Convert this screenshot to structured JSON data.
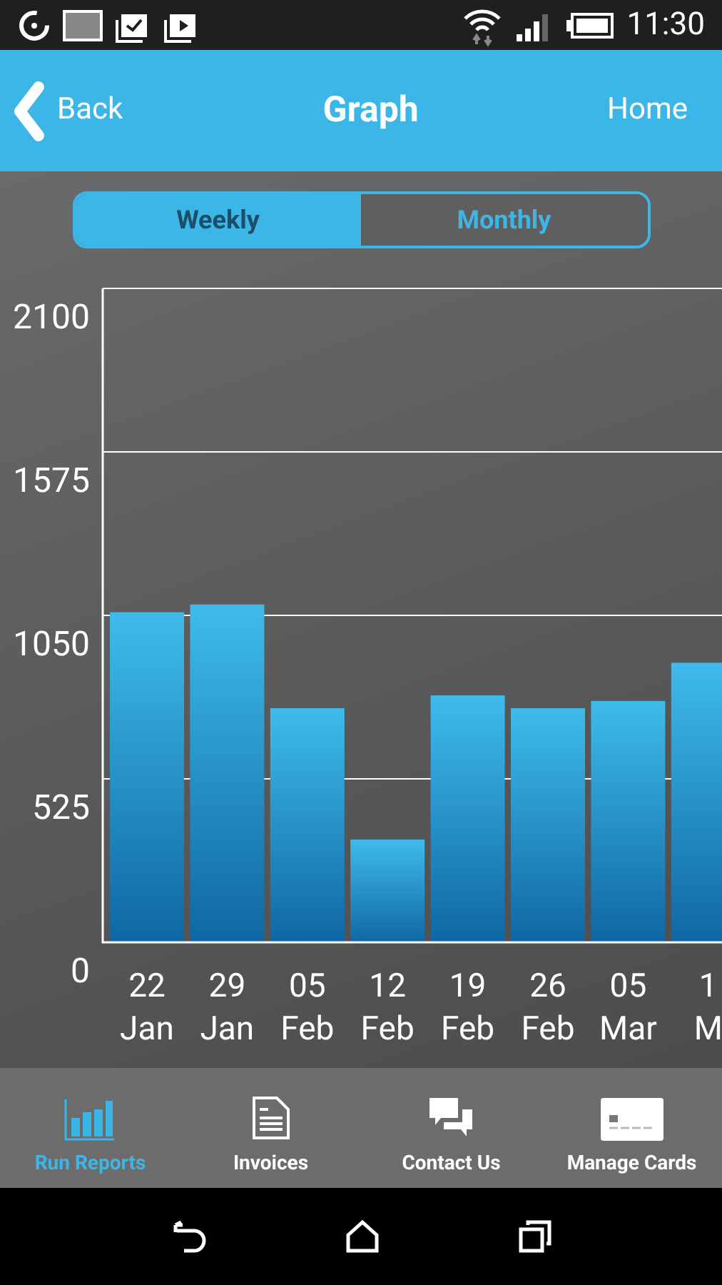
{
  "status_bar": {
    "time": "11:30"
  },
  "header": {
    "back": "Back",
    "title": "Graph",
    "home": "Home"
  },
  "tabs": [
    {
      "label": "Weekly",
      "selected": true
    },
    {
      "label": "Monthly",
      "selected": false
    }
  ],
  "chart_data": {
    "type": "bar",
    "categories": [
      "22 Jan",
      "29 Jan",
      "05 Feb",
      "12 Feb",
      "19 Feb",
      "26 Feb",
      "05 Mar",
      "1 M"
    ],
    "values": [
      1060,
      1085,
      752,
      330,
      793,
      752,
      775,
      898
    ],
    "ylim": [
      0,
      2100
    ],
    "grid": true,
    "yticks": [
      0,
      525,
      1050,
      1575,
      2100
    ]
  },
  "bottom_nav": [
    {
      "label": "Run Reports",
      "kind": "reports",
      "selected": true
    },
    {
      "label": "Invoices",
      "kind": "invoices",
      "selected": false
    },
    {
      "label": "Contact Us",
      "kind": "contact",
      "selected": false
    },
    {
      "label": "Manage Cards",
      "kind": "cards",
      "selected": false
    }
  ]
}
